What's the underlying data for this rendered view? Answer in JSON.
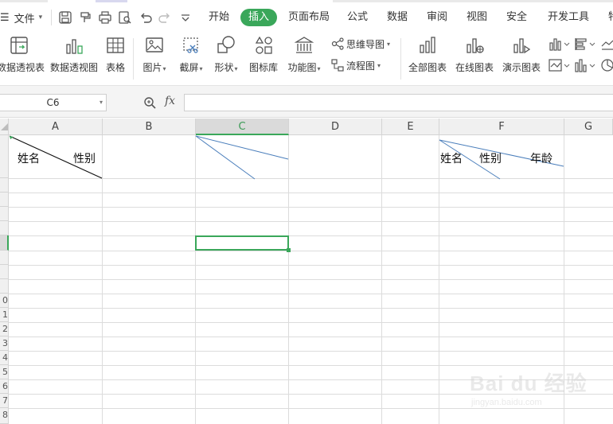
{
  "menubar": {
    "file_label": "文件",
    "tabs": [
      "开始",
      "插入",
      "页面布局",
      "公式",
      "数据",
      "审阅",
      "视图",
      "安全",
      "开发工具",
      "特"
    ],
    "active_tab": "插入"
  },
  "ribbon": {
    "buttons": [
      "数据透视表",
      "数据透视图",
      "表格",
      "图片",
      "截屏",
      "形状",
      "图标库",
      "功能图",
      "全部图表",
      "在线图表",
      "演示图表"
    ],
    "small": [
      "思维导图",
      "流程图"
    ]
  },
  "formula_bar": {
    "name_box": "C6",
    "fx_label": "fx",
    "formula_value": ""
  },
  "sheet": {
    "columns": [
      "A",
      "B",
      "C",
      "D",
      "E",
      "F",
      "G"
    ],
    "selected_column": "C",
    "rows": [
      "",
      "",
      "",
      "",
      "",
      "",
      "",
      "",
      "",
      "0",
      "1",
      "2",
      "3",
      "4",
      "5",
      "6",
      "7",
      "8"
    ],
    "cells": {
      "a1_left": "姓名",
      "a1_right": "性别",
      "f1_1": "姓名",
      "f1_2": "性别",
      "f1_3": "年龄"
    },
    "selected_cell": "C6"
  },
  "watermark": {
    "brand": "Bai du 经验",
    "url": "jingyan.baidu.com"
  },
  "colors": {
    "accent": "#3aa75a",
    "line_blue": "#4a7ebb"
  }
}
